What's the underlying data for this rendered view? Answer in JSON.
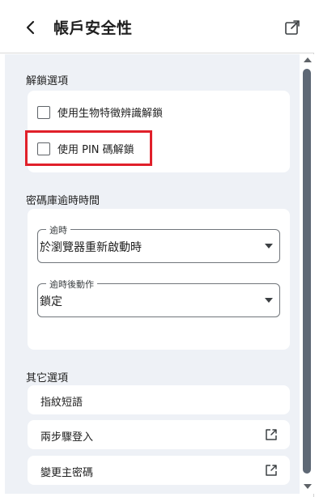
{
  "header": {
    "title": "帳戶安全性",
    "back_icon": "chevron-left-icon",
    "popout_icon": "open-in-new-window-icon"
  },
  "sections": {
    "unlock": {
      "title": "解鎖選項",
      "options": [
        {
          "label": "使用生物特徵辨識解鎖",
          "checked": false
        },
        {
          "label": "使用 PIN 碼解鎖",
          "checked": false,
          "highlighted": true
        }
      ]
    },
    "timeout": {
      "title": "密碼庫逾時時間",
      "timeout_field": {
        "legend": "逾時",
        "value": "於瀏覽器重新啟動時"
      },
      "action_field": {
        "legend": "逾時後動作",
        "value": "鎖定"
      }
    },
    "other": {
      "title": "其它選項",
      "links": [
        {
          "label": "指紋短語",
          "external": false
        },
        {
          "label": "兩步驟登入",
          "external": true
        },
        {
          "label": "變更主密碼",
          "external": true
        }
      ]
    }
  },
  "colors": {
    "content_bg": "#eef1f6",
    "highlight_border": "#e0202a",
    "scroll_thumb": "#5e6875"
  }
}
